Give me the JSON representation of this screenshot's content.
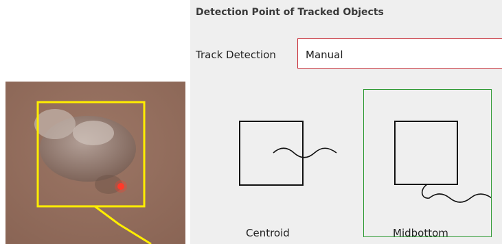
{
  "panel": {
    "title": "Detection Point of Tracked Objects",
    "track_detection_label": "Track Detection",
    "track_detection_value": "Manual",
    "selected_option": "Midbottom",
    "options": [
      {
        "label": "Centroid",
        "icon": "centroid-diagram-icon"
      },
      {
        "label": "Midbottom",
        "icon": "midbottom-diagram-icon"
      }
    ]
  },
  "thumbnail": {
    "icon": "tracked-object-frame",
    "bounding_box_color": "#ffee00"
  },
  "colors": {
    "dropdown_border": "#c9303a",
    "selected_border": "#2e9a33",
    "panel_bg": "#efefef"
  }
}
